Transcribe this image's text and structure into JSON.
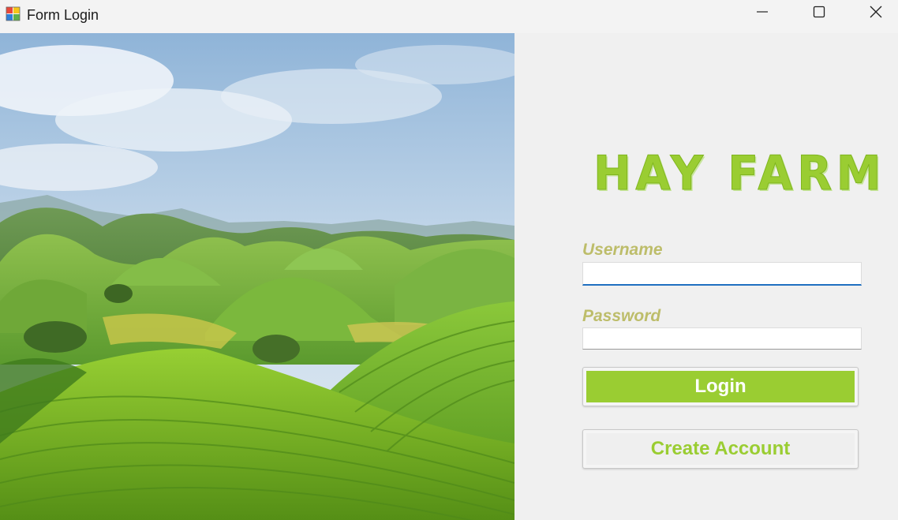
{
  "window": {
    "title": "Form Login"
  },
  "brand": {
    "title": "HAY FARM"
  },
  "form": {
    "username_label": "Username",
    "username_value": "",
    "password_label": "Password",
    "password_value": "",
    "login_label": "Login",
    "create_account_label": "Create Account"
  },
  "colors": {
    "accent": "#9acd32",
    "label": "#bdbd6a",
    "focus_underline": "#1f6fc1"
  },
  "icons": {
    "app": "app-icon",
    "minimize": "minimize-icon",
    "maximize": "maximize-icon",
    "close": "close-icon"
  }
}
